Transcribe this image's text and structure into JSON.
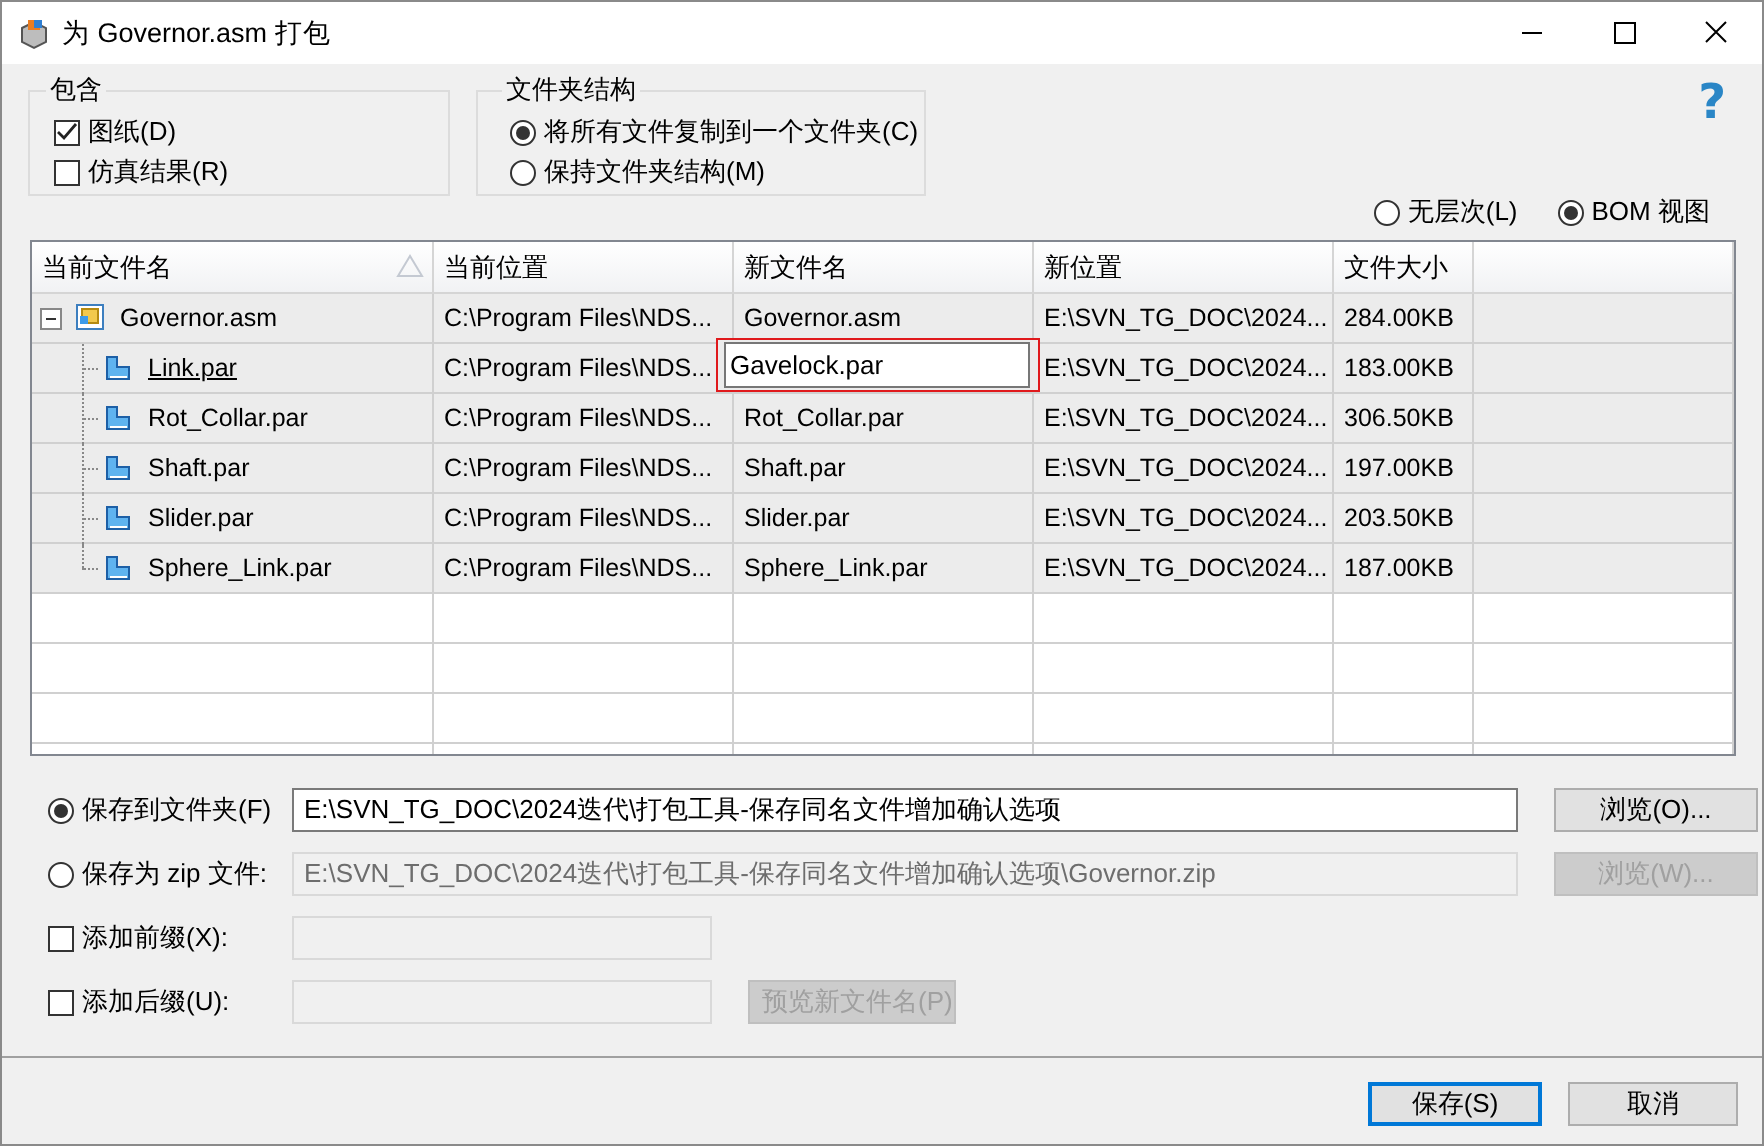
{
  "window": {
    "title": "为 Governor.asm 打包"
  },
  "help": {
    "glyph": "?"
  },
  "include": {
    "title": "包含",
    "options": [
      {
        "label": "图纸(D)",
        "checked": true
      },
      {
        "label": "仿真结果(R)",
        "checked": false
      }
    ]
  },
  "folder_structure": {
    "title": "文件夹结构",
    "options": [
      {
        "label": "将所有文件复制到一个文件夹(C)",
        "selected": true
      },
      {
        "label": "保持文件夹结构(M)",
        "selected": false
      }
    ]
  },
  "view_options": [
    {
      "label": "无层次(L)",
      "selected": false
    },
    {
      "label": "BOM 视图",
      "selected": true
    }
  ],
  "table": {
    "columns": [
      {
        "label": "当前文件名",
        "sorted": true
      },
      {
        "label": "当前位置",
        "sorted": false
      },
      {
        "label": "新文件名",
        "sorted": false
      },
      {
        "label": "新位置",
        "sorted": false
      },
      {
        "label": "文件大小",
        "sorted": false
      }
    ],
    "rows": [
      {
        "kind": "assembly",
        "name": "Governor.asm",
        "expanded": true,
        "focused": false,
        "location": "C:\\Program Files\\NDS...",
        "new_name": "Governor.asm",
        "editing": false,
        "new_location": "E:\\SVN_TG_DOC\\2024...",
        "size": "284.00KB",
        "children": [
          {
            "kind": "part",
            "name": "Link.par",
            "focused": true,
            "location": "C:\\Program Files\\NDS...",
            "new_name": "Gavelock.par",
            "editing": true,
            "new_location": "E:\\SVN_TG_DOC\\2024...",
            "size": "183.00KB"
          },
          {
            "kind": "part",
            "name": "Rot_Collar.par",
            "focused": false,
            "location": "C:\\Program Files\\NDS...",
            "new_name": "Rot_Collar.par",
            "editing": false,
            "new_location": "E:\\SVN_TG_DOC\\2024...",
            "size": "306.50KB"
          },
          {
            "kind": "part",
            "name": "Shaft.par",
            "focused": false,
            "location": "C:\\Program Files\\NDS...",
            "new_name": "Shaft.par",
            "editing": false,
            "new_location": "E:\\SVN_TG_DOC\\2024...",
            "size": "197.00KB"
          },
          {
            "kind": "part",
            "name": "Slider.par",
            "focused": false,
            "location": "C:\\Program Files\\NDS...",
            "new_name": "Slider.par",
            "editing": false,
            "new_location": "E:\\SVN_TG_DOC\\2024...",
            "size": "203.50KB"
          },
          {
            "kind": "part",
            "name": "Sphere_Link.par",
            "focused": false,
            "location": "C:\\Program Files\\NDS...",
            "new_name": "Sphere_Link.par",
            "editing": false,
            "new_location": "E:\\SVN_TG_DOC\\2024...",
            "size": "187.00KB"
          }
        ]
      }
    ]
  },
  "output": {
    "save_to_folder": {
      "label": "保存到文件夹(F)",
      "selected": true,
      "value": "E:\\SVN_TG_DOC\\2024迭代\\打包工具-保存同名文件增加确认选项",
      "disabled": false,
      "browse": {
        "label": "浏览(O)...",
        "disabled": false
      }
    },
    "save_as_zip": {
      "label": "保存为 zip 文件:",
      "selected": false,
      "value": "E:\\SVN_TG_DOC\\2024迭代\\打包工具-保存同名文件增加确认选项\\Governor.zip",
      "disabled": true,
      "browse": {
        "label": "浏览(W)...",
        "disabled": true
      }
    },
    "prefix": {
      "label": "添加前缀(X):",
      "checked": false,
      "disabled": true
    },
    "suffix": {
      "label": "添加后缀(U):",
      "checked": false,
      "disabled": true
    },
    "preview": {
      "label": "预览新文件名(P)",
      "disabled": true
    }
  },
  "buttons": [
    {
      "label": "保存(S)",
      "default": true
    },
    {
      "label": "取消",
      "default": false
    }
  ]
}
